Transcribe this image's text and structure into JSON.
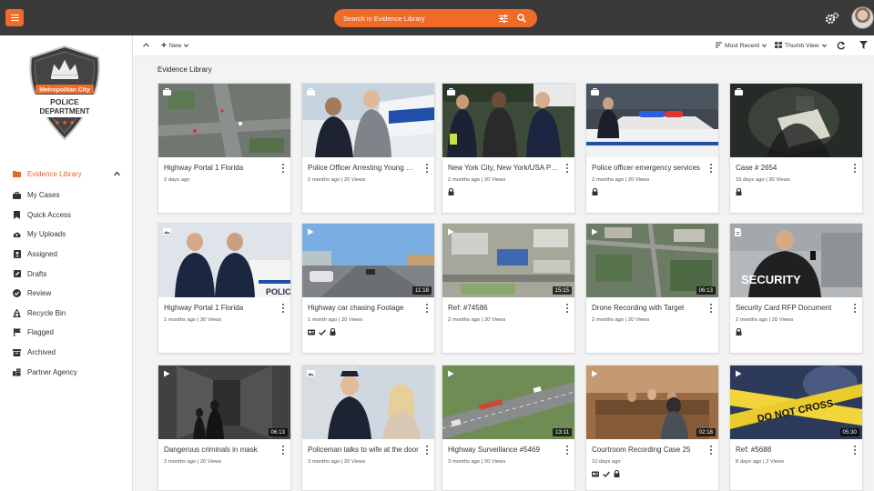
{
  "search": {
    "placeholder": "Search in Evidence Library"
  },
  "sidebar": {
    "logo": {
      "line1": "Metropolitan City",
      "line2": "POLICE",
      "line3": "DEPARTMENT"
    },
    "items": [
      {
        "label": "Evidence Library",
        "icon": "folder-icon"
      },
      {
        "label": "My Cases",
        "icon": "briefcase-icon"
      },
      {
        "label": "Quick Access",
        "icon": "bookmark-icon"
      },
      {
        "label": "My Uploads",
        "icon": "cloud-upload-icon"
      },
      {
        "label": "Assigned",
        "icon": "assigned-icon"
      },
      {
        "label": "Drafts",
        "icon": "draft-icon"
      },
      {
        "label": "Review",
        "icon": "check-circle-icon"
      },
      {
        "label": "Recycle Bin",
        "icon": "recycle-icon"
      },
      {
        "label": "Flagged",
        "icon": "flag-icon"
      },
      {
        "label": "Archived",
        "icon": "archive-icon"
      },
      {
        "label": "Partner Agency",
        "icon": "partner-agency-icon"
      }
    ]
  },
  "toolbar": {
    "new_label": "New",
    "sort_label": "Most Recent",
    "view_label": "Thumb View"
  },
  "main": {
    "title": "Evidence Library",
    "cards": [
      {
        "title": "Highway Portal 1 Florida",
        "meta": "2 days ago",
        "type": "case",
        "lock": false,
        "duration": ""
      },
      {
        "title": "Police Officer Arresting Young Man",
        "meta": "2 months ago | 20 Views",
        "type": "case",
        "lock": false,
        "duration": ""
      },
      {
        "title": "New York City, New York/USA Police Arrest",
        "meta": "2 months ago | 20 Views",
        "type": "case",
        "lock": true,
        "duration": ""
      },
      {
        "title": "Police officer emergency services",
        "meta": "2 months ago | 20 Views",
        "type": "case",
        "lock": true,
        "duration": ""
      },
      {
        "title": "Case # 2654",
        "meta": "15 days ago | 30 Views",
        "type": "case",
        "lock": true,
        "duration": ""
      },
      {
        "title": "Highway Portal 1 Florida",
        "meta": "1 months ago | 30 Views",
        "type": "image",
        "lock": false,
        "duration": ""
      },
      {
        "title": "Highway car chasing Footage",
        "meta": "1 month ago | 20 Views",
        "type": "video",
        "lock": true,
        "checks": true,
        "duration": "11:18"
      },
      {
        "title": "Ref: #74586",
        "meta": "2 months ago | 20 Views",
        "type": "video",
        "lock": false,
        "duration": "15:15"
      },
      {
        "title": "Drone Recording with Target",
        "meta": "2 months ago | 20 Views",
        "type": "video",
        "lock": false,
        "duration": "06:13"
      },
      {
        "title": "Security Card RFP Document",
        "meta": "2 months ago | 20 Views",
        "type": "doc",
        "lock": true,
        "duration": ""
      },
      {
        "title": "Dangerous criminals in mask",
        "meta": "3 months ago | 20 Views",
        "type": "video",
        "lock": false,
        "duration": "06:13"
      },
      {
        "title": "Policeman talks to wife at the door",
        "meta": "3 months ago | 20 Views",
        "type": "image",
        "lock": false,
        "duration": ""
      },
      {
        "title": "Highway Surveillance #5469",
        "meta": "3 months ago | 20 Views",
        "type": "video",
        "lock": false,
        "duration": "13:11"
      },
      {
        "title": "Courtroom Recording Case 25",
        "meta": "10 days ago",
        "type": "video",
        "lock": true,
        "checks": true,
        "duration": "02:18"
      },
      {
        "title": "Ref: #5688",
        "meta": "8 days ago | 2 Views",
        "type": "video",
        "lock": false,
        "duration": "05:30"
      }
    ]
  },
  "colors": {
    "accent": "#f06a28",
    "topbar": "#3a3a3a",
    "active_nav": "#e8682a"
  }
}
